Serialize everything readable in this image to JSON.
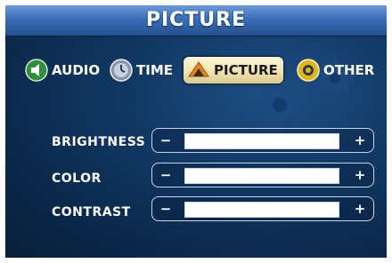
{
  "header": {
    "title": "PICTURE"
  },
  "tabs": [
    {
      "label": "AUDIO",
      "icon": "speaker-icon",
      "active": false
    },
    {
      "label": "TIME",
      "icon": "clock-icon",
      "active": false
    },
    {
      "label": "PICTURE",
      "icon": "picture-icon",
      "active": true
    },
    {
      "label": "OTHER",
      "icon": "gear-icon",
      "active": false
    }
  ],
  "sliders": [
    {
      "label": "BRIGHTNESS",
      "minus": "−",
      "plus": "+"
    },
    {
      "label": "COLOR",
      "minus": "−",
      "plus": "+"
    },
    {
      "label": "CONTRAST",
      "minus": "−",
      "plus": "+"
    }
  ],
  "colors": {
    "header": "#3c6fb8",
    "background": "#123a66",
    "active_tab": "#f2e6b2",
    "slider_fill": "#ffffff"
  }
}
